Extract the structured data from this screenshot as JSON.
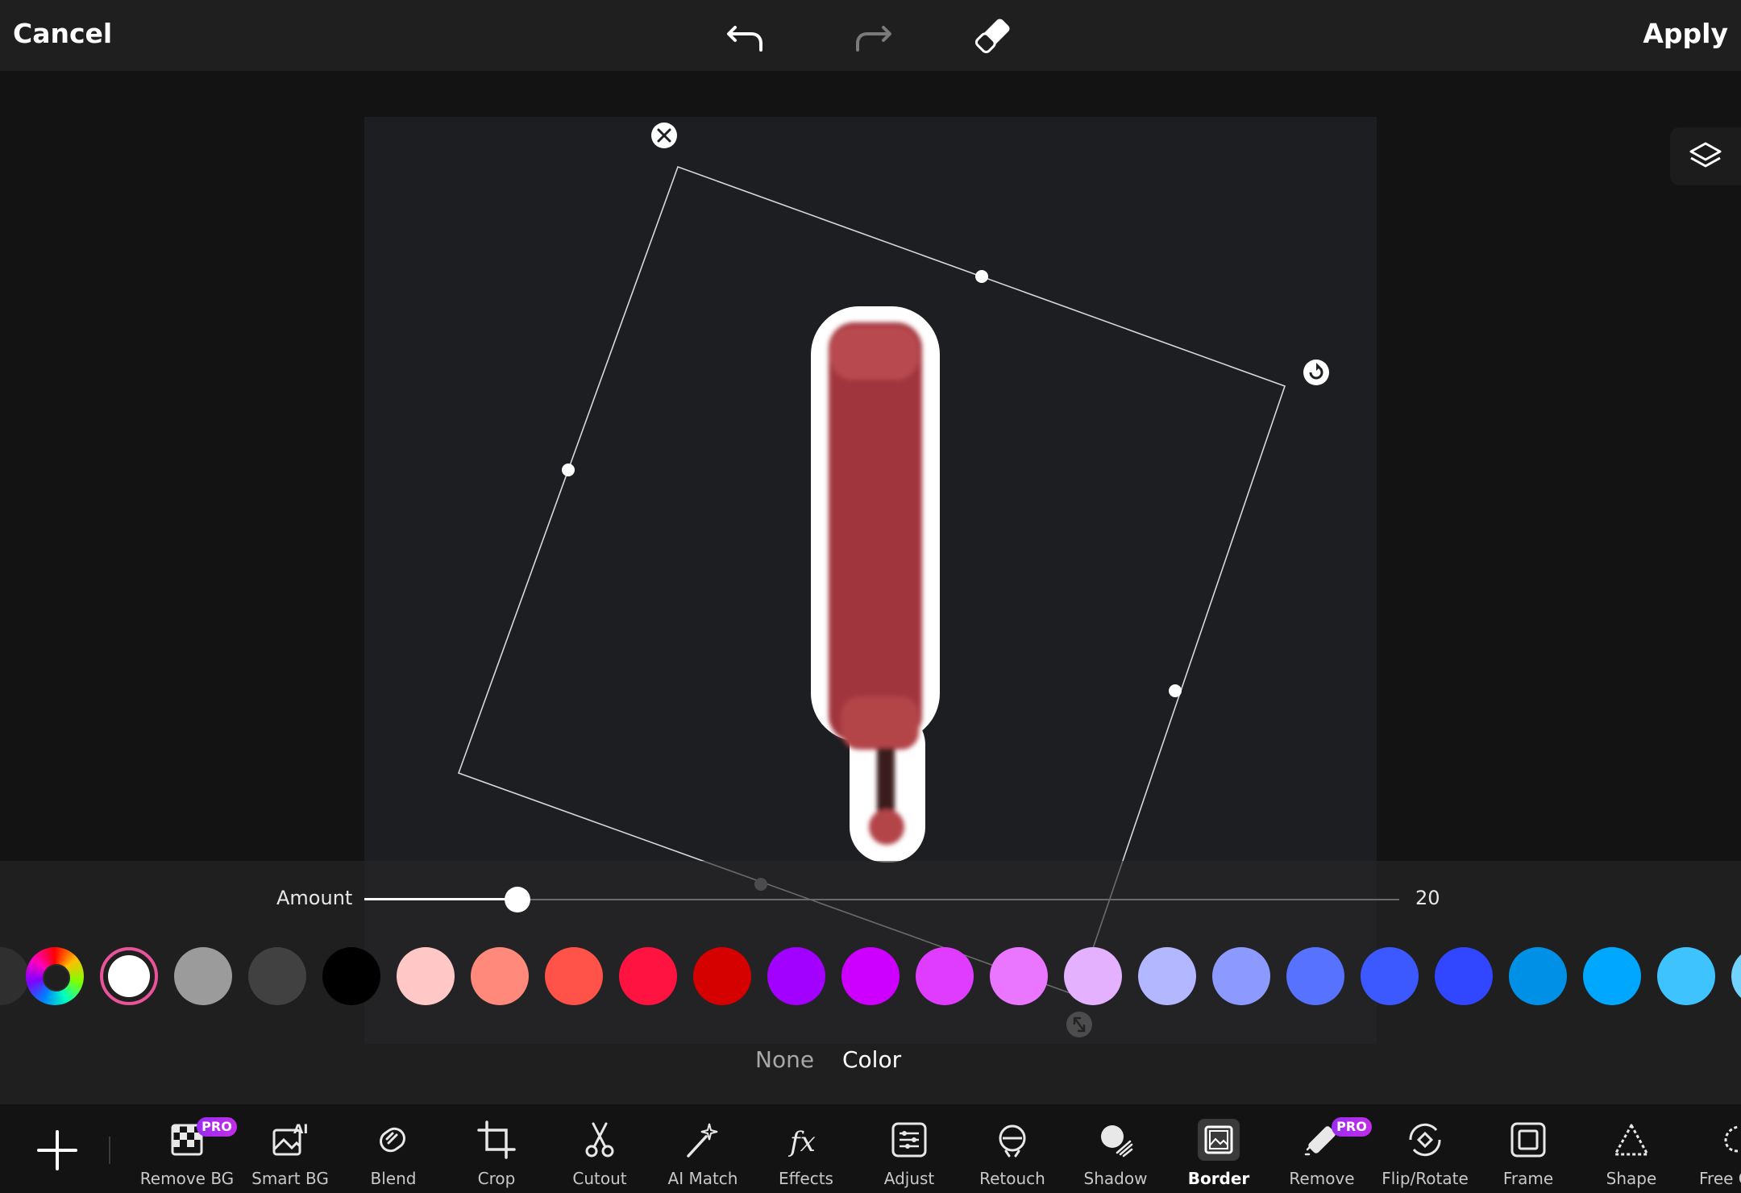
{
  "topbar": {
    "cancel_label": "Cancel",
    "apply_label": "Apply"
  },
  "panel": {
    "amount_label": "Amount",
    "amount_value": "20",
    "amount_fraction": 0.2,
    "tabs": {
      "none": "None",
      "color": "Color"
    }
  },
  "swatches": [
    "#ffffff",
    "#9b9b9b",
    "#414141",
    "#000000",
    "#ffc7c5",
    "#ff8a7b",
    "#ff5349",
    "#ff1441",
    "#d50000",
    "#a200ff",
    "#cd00ff",
    "#e03cff",
    "#ea75ff",
    "#e3b1ff",
    "#b2b7ff",
    "#8c9aff",
    "#5672ff",
    "#3c58ff",
    "#3046ff",
    "#0090e6",
    "#00a7ff",
    "#3ec3ff"
  ],
  "toolbar": {
    "pro_badge": "PRO",
    "tools": [
      {
        "label": "Remove BG"
      },
      {
        "label": "Smart BG"
      },
      {
        "label": "Blend"
      },
      {
        "label": "Crop"
      },
      {
        "label": "Cutout"
      },
      {
        "label": "AI Match"
      },
      {
        "label": "Effects"
      },
      {
        "label": "Adjust"
      },
      {
        "label": "Retouch"
      },
      {
        "label": "Shadow"
      },
      {
        "label": "Border"
      },
      {
        "label": "Remove"
      },
      {
        "label": "Flip/Rotate"
      },
      {
        "label": "Frame"
      },
      {
        "label": "Shape"
      },
      {
        "label": "Free C"
      }
    ]
  },
  "icons": {
    "undo": "undo-icon",
    "redo": "redo-icon",
    "eraser": "eraser-icon",
    "layers": "layers-icon",
    "delete": "close-icon",
    "rotate": "rotate-icon",
    "scale": "scale-icon"
  }
}
